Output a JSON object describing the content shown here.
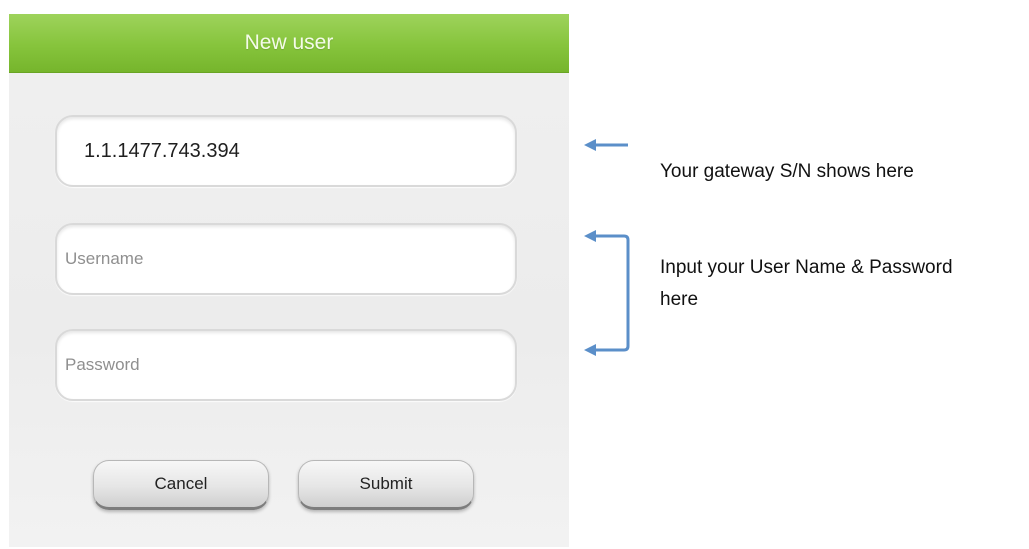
{
  "dialog": {
    "title": "New user",
    "serial_value": "1.1.1477.743.394",
    "username_placeholder": "Username",
    "password_placeholder": "Password",
    "cancel_label": "Cancel",
    "submit_label": "Submit"
  },
  "annotations": {
    "serial_note": "Your gateway S/N shows here",
    "credentials_note": "Input your User Name & Password here"
  },
  "colors": {
    "titlebar": "#86c43c",
    "arrow": "#5b8fc9"
  },
  "icons": [
    "arrow-left-icon",
    "bracket-arrow-icon"
  ]
}
